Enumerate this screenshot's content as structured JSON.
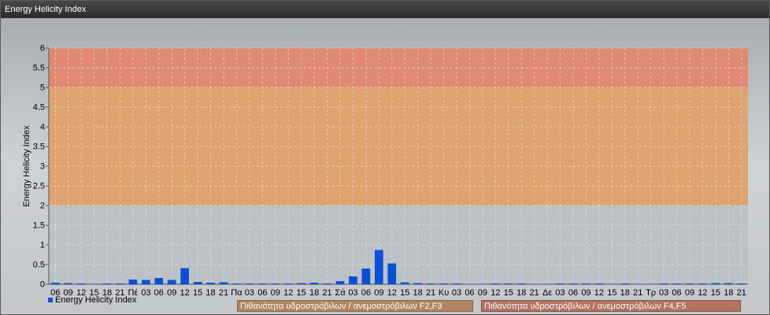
{
  "window": {
    "title": "Energy Helicity Index"
  },
  "chart_data": {
    "type": "bar",
    "ylabel": "Energy Helicity Index",
    "ylim": [
      0,
      6
    ],
    "yticks": [
      "0",
      "0.5",
      "1",
      "1.5",
      "2",
      "2.5",
      "3",
      "3.5",
      "4",
      "4.5",
      "5",
      "5.5",
      "6"
    ],
    "categories": [
      "06",
      "09",
      "12",
      "15",
      "18",
      "21",
      "Πέ",
      "03",
      "06",
      "09",
      "12",
      "15",
      "18",
      "21",
      "Πα",
      "03",
      "06",
      "09",
      "12",
      "15",
      "18",
      "21",
      "Σά",
      "03",
      "06",
      "09",
      "12",
      "15",
      "18",
      "21",
      "Κυ",
      "03",
      "06",
      "09",
      "12",
      "15",
      "18",
      "21",
      "Δε",
      "03",
      "06",
      "09",
      "12",
      "15",
      "18",
      "21",
      "Τρ",
      "03",
      "06",
      "09",
      "12",
      "15",
      "18",
      "21"
    ],
    "series": [
      {
        "name": "Energy Helicity Index",
        "color": "#0a4fd6",
        "values": [
          0.04,
          0.03,
          0.02,
          0.01,
          0.02,
          0.02,
          0.12,
          0.11,
          0.16,
          0.11,
          0.41,
          0.06,
          0.04,
          0.05,
          0.02,
          0.02,
          0.02,
          0.02,
          0.02,
          0.03,
          0.04,
          0.02,
          0.08,
          0.2,
          0.4,
          0.87,
          0.53,
          0.05,
          0.03,
          0.02,
          0.02,
          0.02,
          0.01,
          0.01,
          0.02,
          0.02,
          0.02,
          0.01,
          0.01,
          0.02,
          0.02,
          0.02,
          0.02,
          0.01,
          0.02,
          0.01,
          0.01,
          0.02,
          0.02,
          0.02,
          0.02,
          0.03,
          0.03,
          0.02
        ]
      }
    ],
    "bands": [
      {
        "from": 0,
        "to": 2,
        "color": "#bcc1c6"
      },
      {
        "from": 2,
        "to": 5,
        "color": "#dfa36f",
        "label": "Πιθανότητα υδροστρόβιλων / ανεμοστρόβιλων F2,F3"
      },
      {
        "from": 5,
        "to": 6,
        "color": "#df8a70",
        "label": "Πιθανότητα υδροστρόβιλων / ανεμοστρόβιλων F4,F5"
      }
    ],
    "grid": true,
    "legend": "bottom-left"
  }
}
